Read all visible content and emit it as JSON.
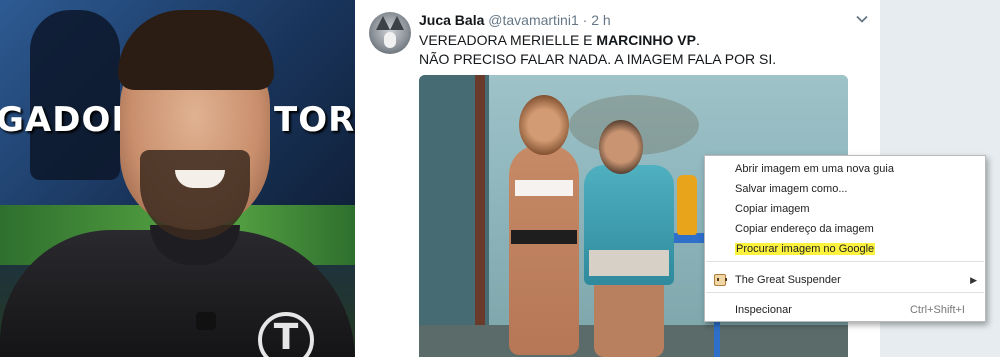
{
  "left_photo": {
    "banner_left": "GADORES",
    "banner_right": "TORC",
    "shirt_logo": "T"
  },
  "tweet": {
    "author_name": "Juca Bala",
    "author_handle": "@tavamartini1",
    "separator": "·",
    "time": "2 h",
    "line1_prefix": "VEREADORA MERIELLE E ",
    "line1_bold": "MARCINHO VP",
    "line1_suffix": ".",
    "line2": "NÃO PRECISO FALAR NADA. A IMAGEM FALA POR SI.",
    "menu_icon": "chevron-down-icon"
  },
  "context_menu": {
    "items": [
      {
        "label": "Abrir imagem em uma nova guia"
      },
      {
        "label": "Salvar imagem como..."
      },
      {
        "label": "Copiar imagem"
      },
      {
        "label": "Copiar endereço da imagem"
      },
      {
        "label": "Procurar imagem no Google",
        "highlighted": true
      },
      {
        "label": "The Great Suspender",
        "submenu": true,
        "icon": "extension-icon"
      },
      {
        "label": "Inspecionar",
        "shortcut": "Ctrl+Shift+I"
      }
    ],
    "submenu_arrow": "▶",
    "highlight_color": "#fdf33f"
  },
  "colors": {
    "text_primary": "#14171a",
    "text_secondary": "#657786",
    "page_bg": "#e6ecf0"
  }
}
